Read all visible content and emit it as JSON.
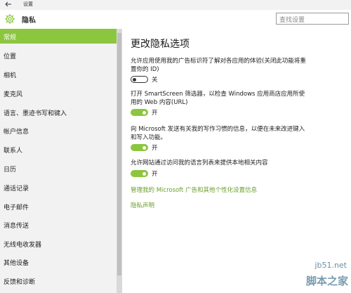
{
  "window": {
    "title": "设置",
    "back_icon": "back-arrow-icon"
  },
  "header": {
    "section_title": "隐私",
    "icon": "gear-icon",
    "search_placeholder": "查找设置"
  },
  "accent_color": "#8cc63f",
  "sidebar": {
    "items": [
      {
        "label": "常规",
        "active": true
      },
      {
        "label": "位置"
      },
      {
        "label": "相机"
      },
      {
        "label": "麦克风"
      },
      {
        "label": "语言、墨迹书写和键入"
      },
      {
        "label": "帐户信息"
      },
      {
        "label": "联系人"
      },
      {
        "label": "日历"
      },
      {
        "label": "通话记录"
      },
      {
        "label": "电子邮件"
      },
      {
        "label": "消息传送"
      },
      {
        "label": "无线电收发器"
      },
      {
        "label": "其他设备"
      },
      {
        "label": "反馈和诊断"
      }
    ]
  },
  "main": {
    "title": "更改隐私选项",
    "options": [
      {
        "description": "允许应用使用我的广告标识符了解对各应用的体验(关闭此功能将重置你的 ID)",
        "state": "关",
        "on": false
      },
      {
        "description": "打开 SmartScreen 筛选器，以检查 Windows 应用商店应用所使用的 Web 内容(URL)",
        "state": "开",
        "on": true
      },
      {
        "description": "向 Microsoft 发送有关我的写作习惯的信息，以便在未来改进键入和写入功能。",
        "state": "开",
        "on": true
      },
      {
        "description": "允许网站通过访问我的语言列表来提供本地相关内容",
        "state": "开",
        "on": true
      }
    ],
    "links": {
      "ads_link": "管理我的 Microsoft 广告和其他个性化设置信息",
      "privacy_link": "隐私声明"
    }
  },
  "watermark": {
    "top": "jb51.net",
    "bottom": "脚本之家"
  }
}
